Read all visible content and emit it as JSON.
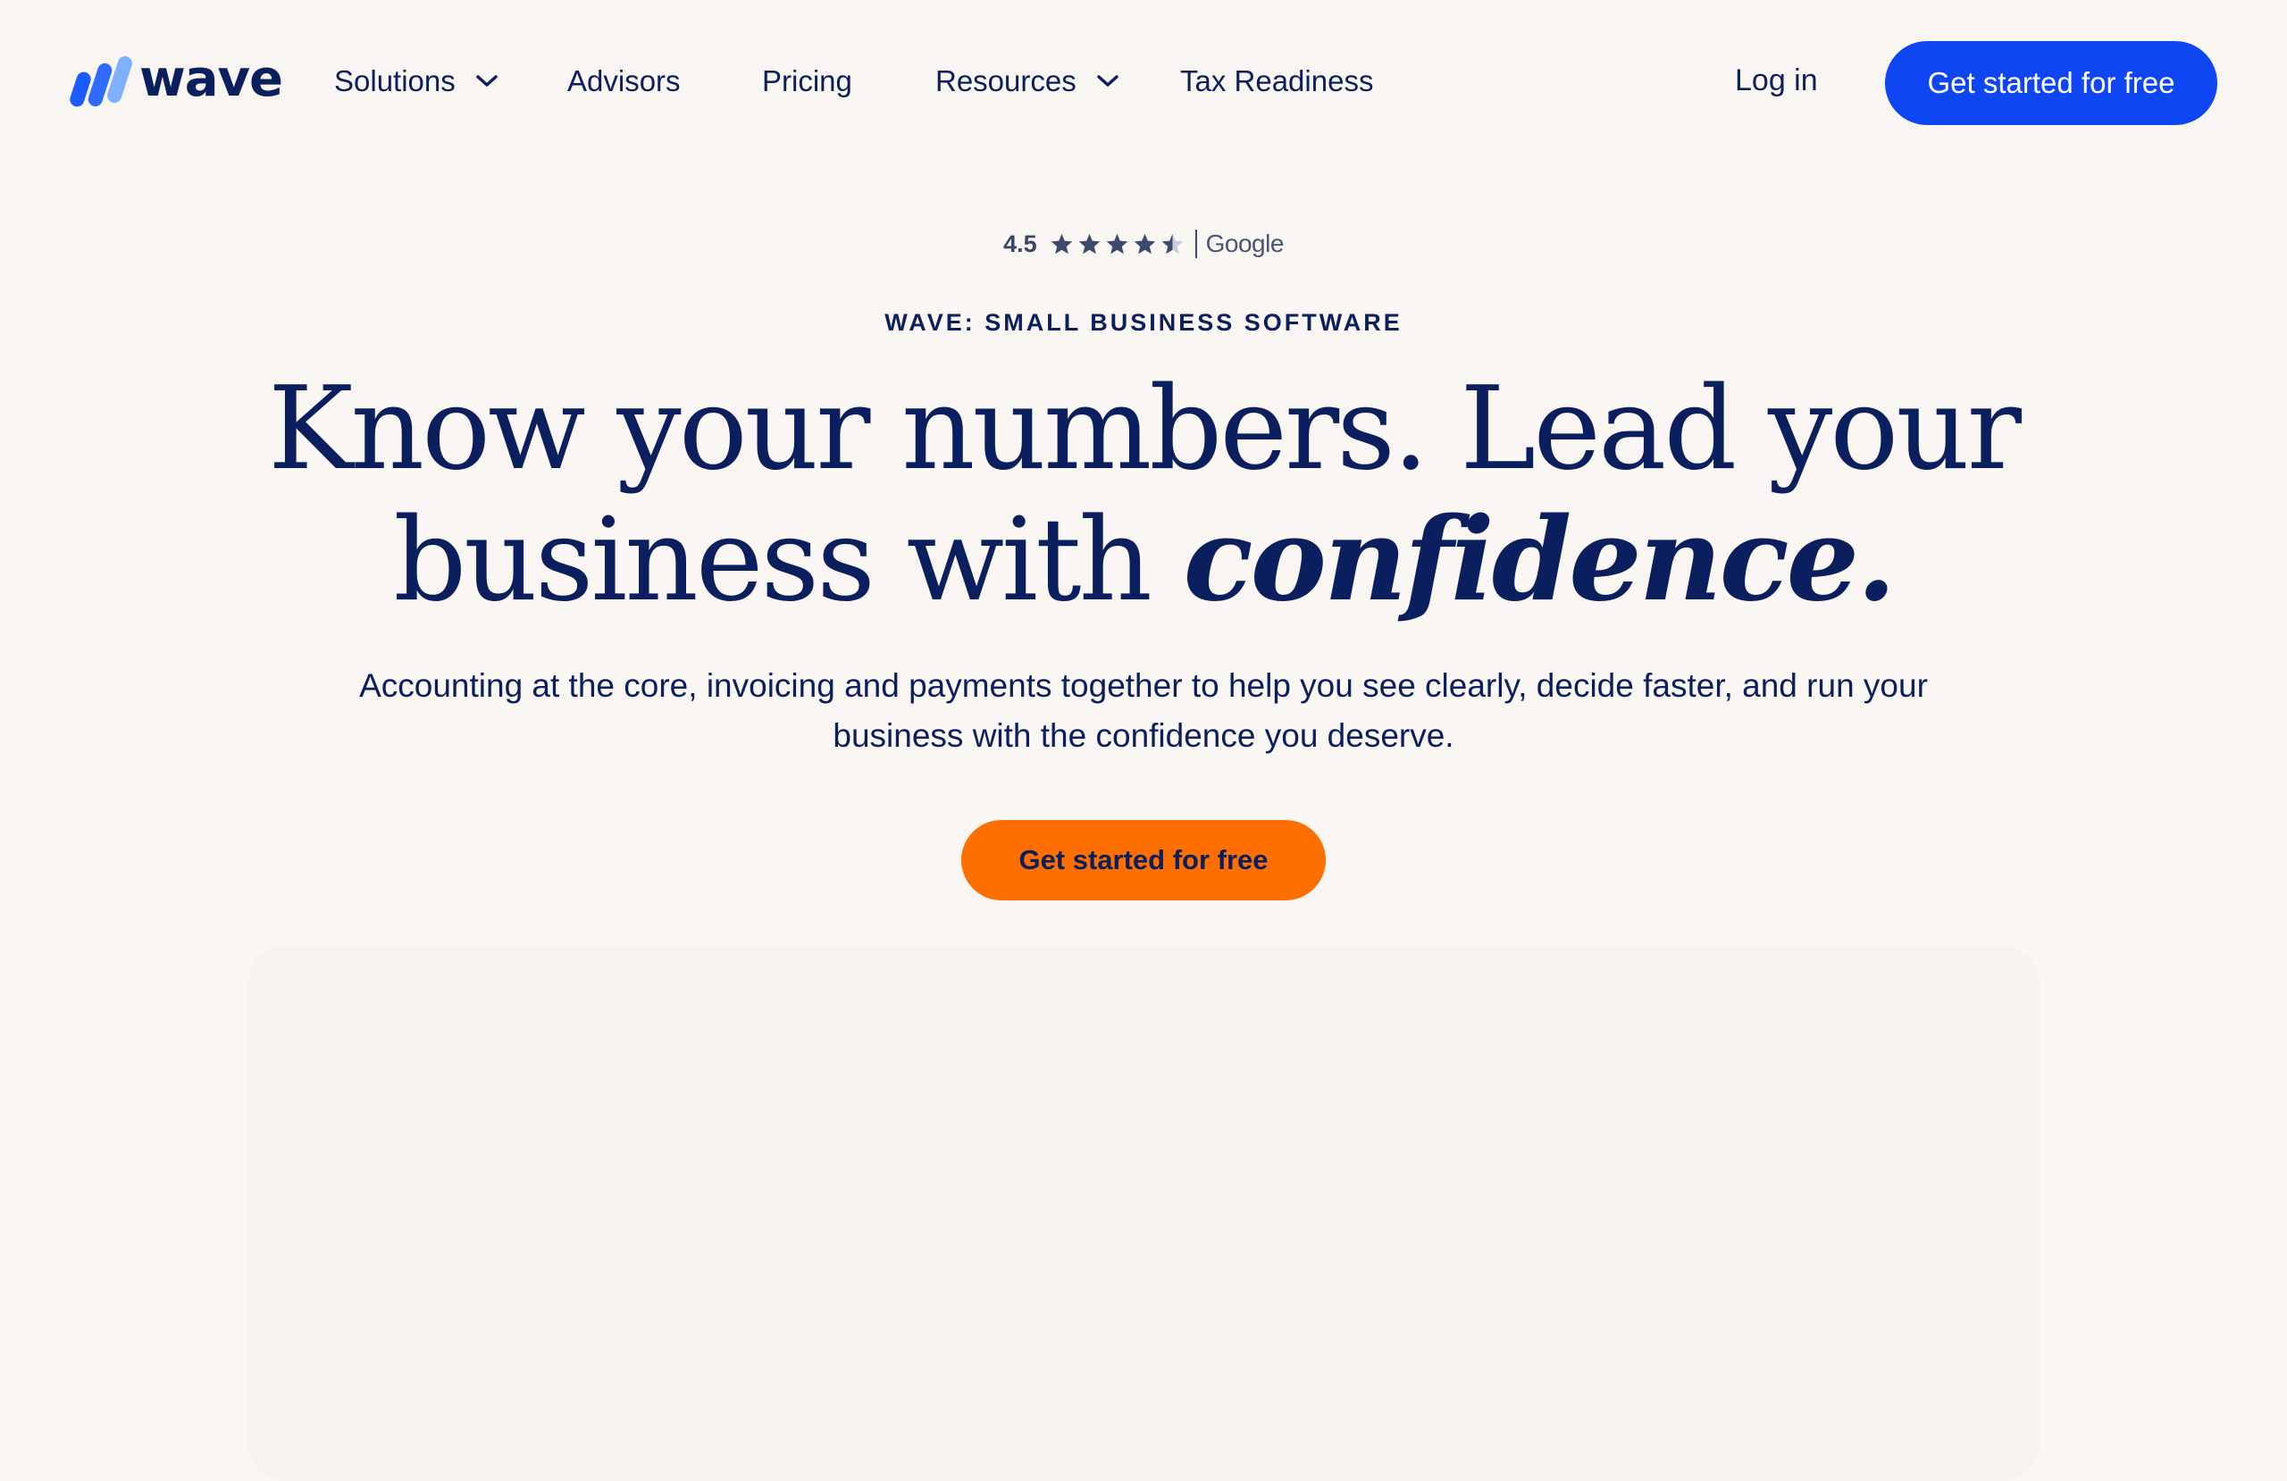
{
  "header": {
    "logo_text": "wave",
    "nav": {
      "solutions": "Solutions",
      "advisors": "Advisors",
      "pricing": "Pricing",
      "resources": "Resources",
      "tax": "Tax Readiness"
    },
    "login": "Log in",
    "cta": "Get started for free"
  },
  "rating": {
    "score": "4.5",
    "stars": 4.5,
    "max_stars": 5,
    "source": "Google"
  },
  "hero": {
    "eyebrow": "WAVE: SMALL BUSINESS SOFTWARE",
    "headline_line1": "Know your numbers. Lead your",
    "headline_line2": "business with",
    "headline_emphasis": "confidence.",
    "subtext_line1": "Accounting at the core, invoicing and payments together to help you see clearly, decide faster, and run your",
    "subtext_line2": "business with the confidence you deserve.",
    "cta": "Get started for free"
  },
  "colors": {
    "background": "#f9f6f4",
    "navy": "#0b1f5e",
    "primary_blue": "#0f46f4",
    "orange": "#ff6f00"
  }
}
